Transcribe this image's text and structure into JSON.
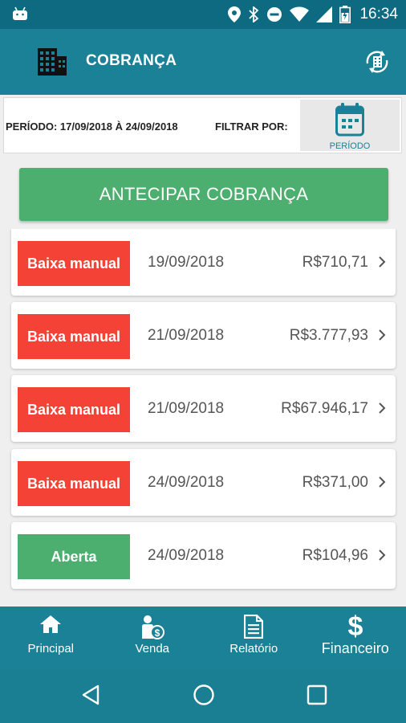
{
  "status_bar": {
    "time": "16:34",
    "icons": [
      "android-icon",
      "location-icon",
      "bluetooth-icon",
      "do-not-disturb-icon",
      "wifi-icon",
      "signal-icon",
      "battery-icon"
    ]
  },
  "app_bar": {
    "title": "COBRANÇA",
    "icons": [
      "building-icon",
      "sync-icon"
    ]
  },
  "filter": {
    "periodo_text": "PERÍODO: 17/09/2018 À 24/09/2018",
    "filtrar_label": "FILTRAR POR:",
    "periodo_button_label": "PERÍODO"
  },
  "antecipar_label": "ANTECIPAR COBRANÇA",
  "rows": [
    {
      "status": "Baixa manual",
      "date": "19/09/2018",
      "amount": "R$710,71"
    },
    {
      "status": "Baixa manual",
      "date": "21/09/2018",
      "amount": "R$3.777,93"
    },
    {
      "status": "Baixa manual",
      "date": "21/09/2018",
      "amount": "R$67.946,17"
    },
    {
      "status": "Baixa manual",
      "date": "24/09/2018",
      "amount": "R$371,00"
    },
    {
      "status": "Aberta",
      "date": "24/09/2018",
      "amount": "R$104,96"
    }
  ],
  "bottom_nav": [
    {
      "label": "Principal",
      "icon": "home-icon"
    },
    {
      "label": "Venda",
      "icon": "person-money-icon"
    },
    {
      "label": "Relatório",
      "icon": "document-icon"
    },
    {
      "label": "Financeiro",
      "icon": "dollar-icon"
    }
  ],
  "colors": {
    "status_bar": "#0d6a80",
    "app_bar": "#1a8197",
    "accent_green": "#4caf6f",
    "status_red": "#f44336"
  }
}
